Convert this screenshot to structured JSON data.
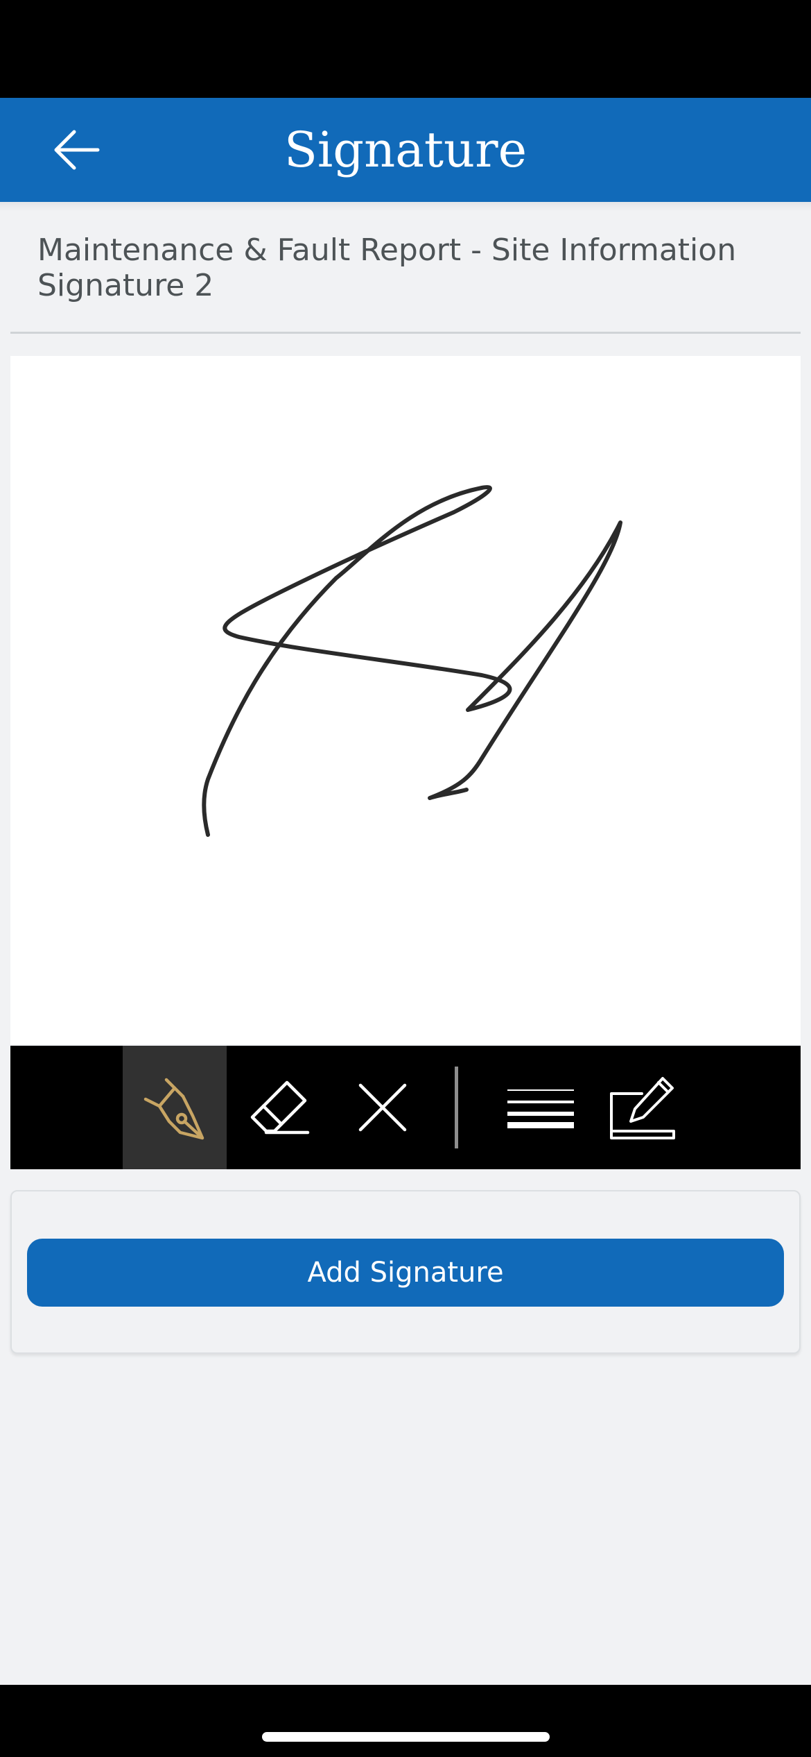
{
  "header": {
    "title": "Signature",
    "back_icon": "arrow-left-icon"
  },
  "form": {
    "caption": "Maintenance & Fault Report - Site Information Signature 2"
  },
  "colors": {
    "brand": "#116ab9",
    "active_tool_icon": "#c8a563",
    "toolbar_background": "#000000",
    "ink": "#2a2a2a"
  },
  "toolbar": {
    "tools": [
      {
        "icon": "pen-nib-icon",
        "active": true
      },
      {
        "icon": "eraser-icon",
        "active": false
      },
      {
        "icon": "close-icon",
        "active": false
      },
      {
        "icon": "line-weight-icon",
        "active": false
      },
      {
        "icon": "edit-pencil-icon",
        "active": false
      }
    ]
  },
  "actions": {
    "add_signature_label": "Add Signature"
  }
}
